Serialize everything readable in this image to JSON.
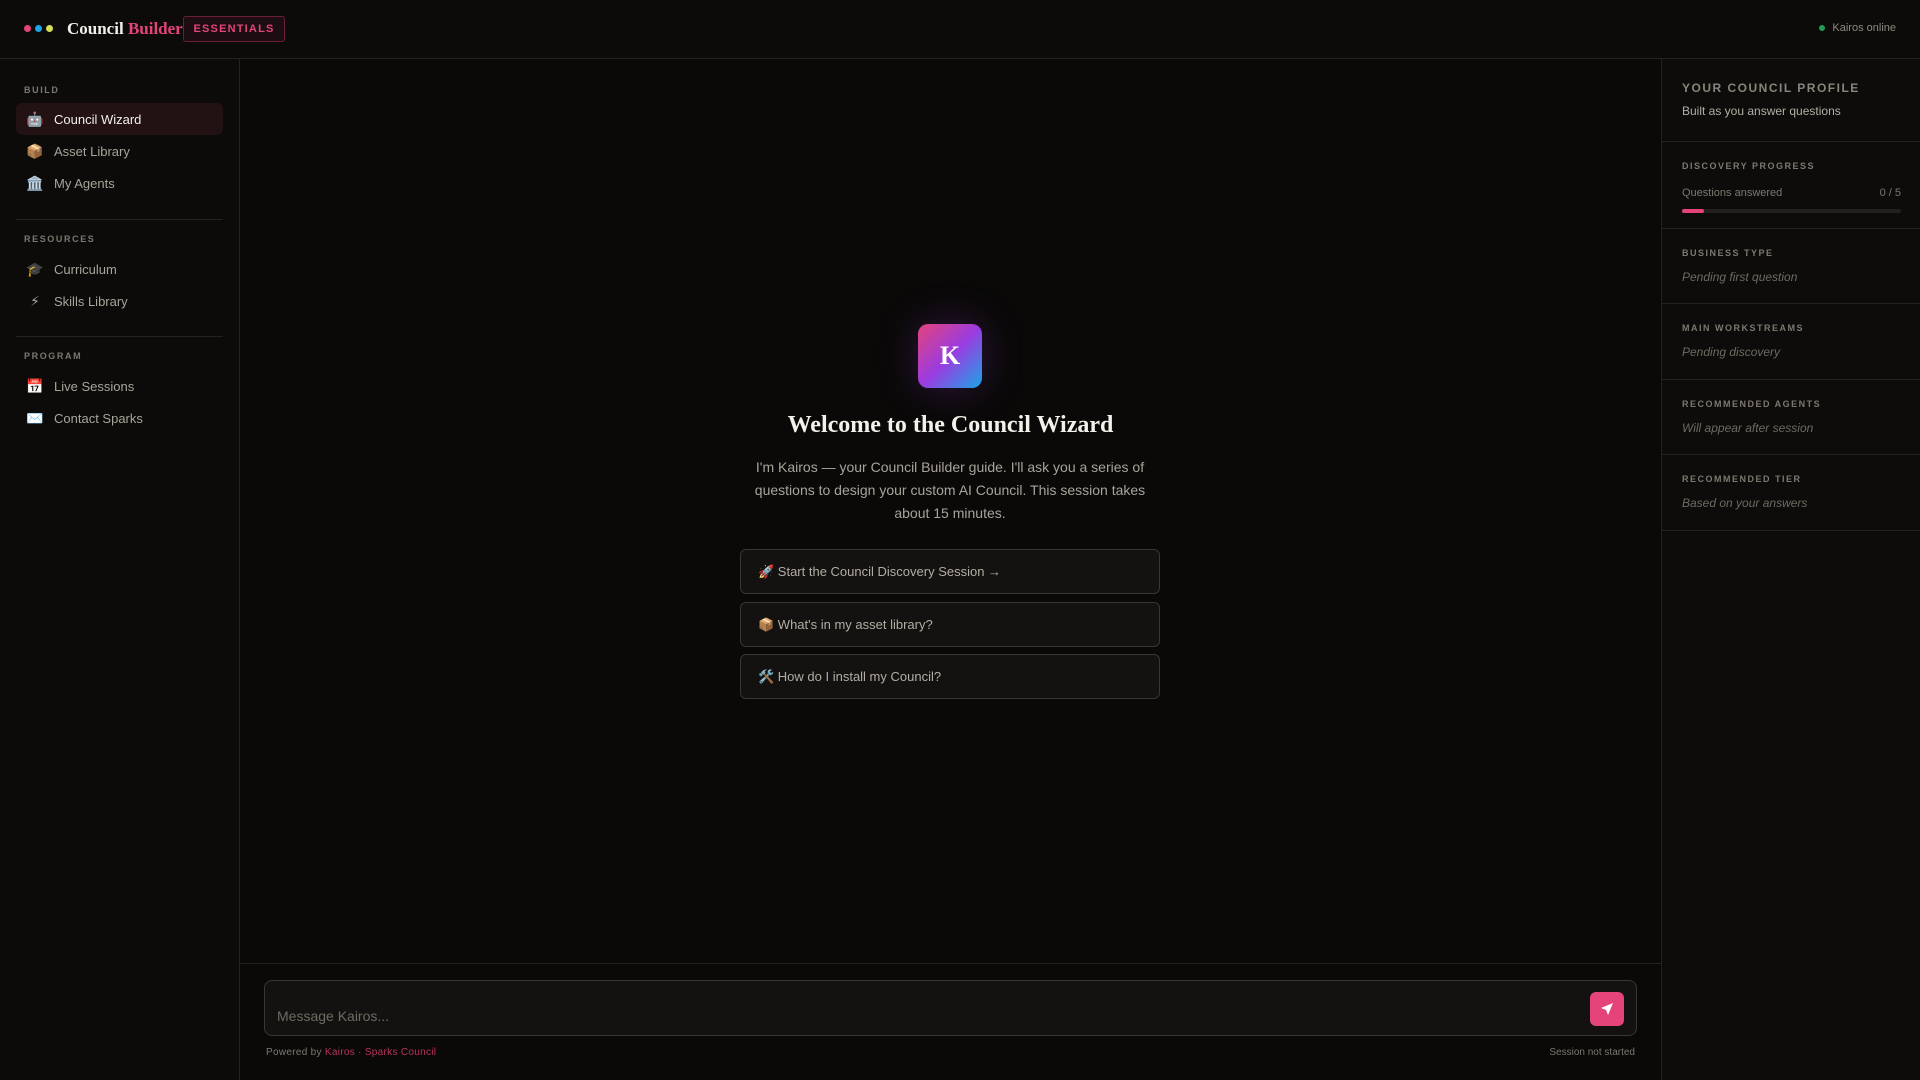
{
  "topbar": {
    "brand_primary": "Council",
    "brand_accent": "Builder",
    "badge": "ESSENTIALS",
    "status": "Kairos online",
    "dot_colors": [
      "#e4447a",
      "#1aa6e6",
      "#d4e157"
    ]
  },
  "sidebar": {
    "sections": [
      {
        "label": "BUILD",
        "items": [
          {
            "label": "Council Wizard",
            "icon": "🤖",
            "icon_name": "robot-icon",
            "active": true
          },
          {
            "label": "Asset Library",
            "icon": "📦",
            "icon_name": "package-icon",
            "active": false
          },
          {
            "label": "My Agents",
            "icon": "🏛️",
            "icon_name": "classical-building-icon",
            "active": false
          }
        ]
      },
      {
        "label": "RESOURCES",
        "items": [
          {
            "label": "Curriculum",
            "icon": "🎓",
            "icon_name": "graduation-cap-icon",
            "active": false
          },
          {
            "label": "Skills Library",
            "icon": "⚡",
            "icon_name": "lightning-icon",
            "active": false
          }
        ]
      },
      {
        "label": "PROGRAM",
        "items": [
          {
            "label": "Live Sessions",
            "icon": "📅",
            "icon_name": "calendar-icon",
            "active": false
          },
          {
            "label": "Contact Sparks",
            "icon": "✉️",
            "icon_name": "envelope-icon",
            "active": false
          }
        ]
      }
    ]
  },
  "main": {
    "logo_letter": "K",
    "title": "Welcome to the Council Wizard",
    "intro": "I'm Kairos — your Council Builder guide. I'll ask you a series of questions to design your custom AI Council. This session takes about 15 minutes.",
    "options": [
      "🚀 Start the Council Discovery Session →",
      "📦 What's in my asset library?",
      "🛠️ How do I install my Council?"
    ],
    "composer": {
      "placeholder": "Message Kairos...",
      "powered_prefix": "Powered by",
      "powered_link": "Kairos · Sparks Council",
      "session_status": "Session not started"
    }
  },
  "profile": {
    "title": "YOUR COUNCIL PROFILE",
    "subtitle": "Built as you answer questions",
    "progress": {
      "label": "DISCOVERY PROGRESS",
      "row_label": "Questions answered",
      "count_text": "0 / 5",
      "fill_fraction": 0.1
    },
    "fields": [
      {
        "label": "BUSINESS TYPE",
        "value": "Pending first question"
      },
      {
        "label": "MAIN WORKSTREAMS",
        "value": "Pending discovery"
      },
      {
        "label": "RECOMMENDED AGENTS",
        "value": "Will appear after session"
      },
      {
        "label": "RECOMMENDED TIER",
        "value": "Based on your answers"
      }
    ]
  }
}
